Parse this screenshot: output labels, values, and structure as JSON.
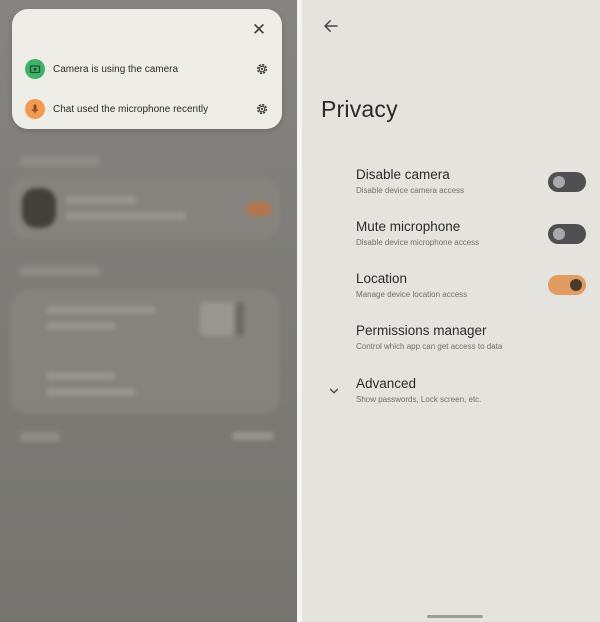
{
  "notification_popup": {
    "close_icon": "close-icon",
    "items": [
      {
        "text": "Camera is using the camera",
        "icon": "camera-icon",
        "badge_color": "#3db36a",
        "settings_icon": "gear-icon"
      },
      {
        "text": "Chat used the microphone recently",
        "icon": "microphone-icon",
        "badge_color": "#f29a52",
        "settings_icon": "gear-icon"
      }
    ]
  },
  "privacy_page": {
    "back_icon": "back-arrow-icon",
    "title": "Privacy",
    "settings": [
      {
        "title": "Disable camera",
        "subtitle": "Disable device camera access",
        "toggle": "off"
      },
      {
        "title": "Mute microphone",
        "subtitle": "Disable device microphone access",
        "toggle": "off"
      },
      {
        "title": "Location",
        "subtitle": "Manage device location access",
        "toggle": "on"
      },
      {
        "title": "Permissions manager",
        "subtitle": "Control which app can get access to data"
      },
      {
        "title": "Advanced",
        "subtitle": "Show passwords, Lock screen, etc.",
        "icon": "chevron-down-icon"
      }
    ]
  },
  "colors": {
    "toggle_on": "#e29b60",
    "toggle_off": "#505052",
    "page_background": "#e4e3dd",
    "popup_background": "#eeede8",
    "left_scrim": "#7b7a76"
  }
}
